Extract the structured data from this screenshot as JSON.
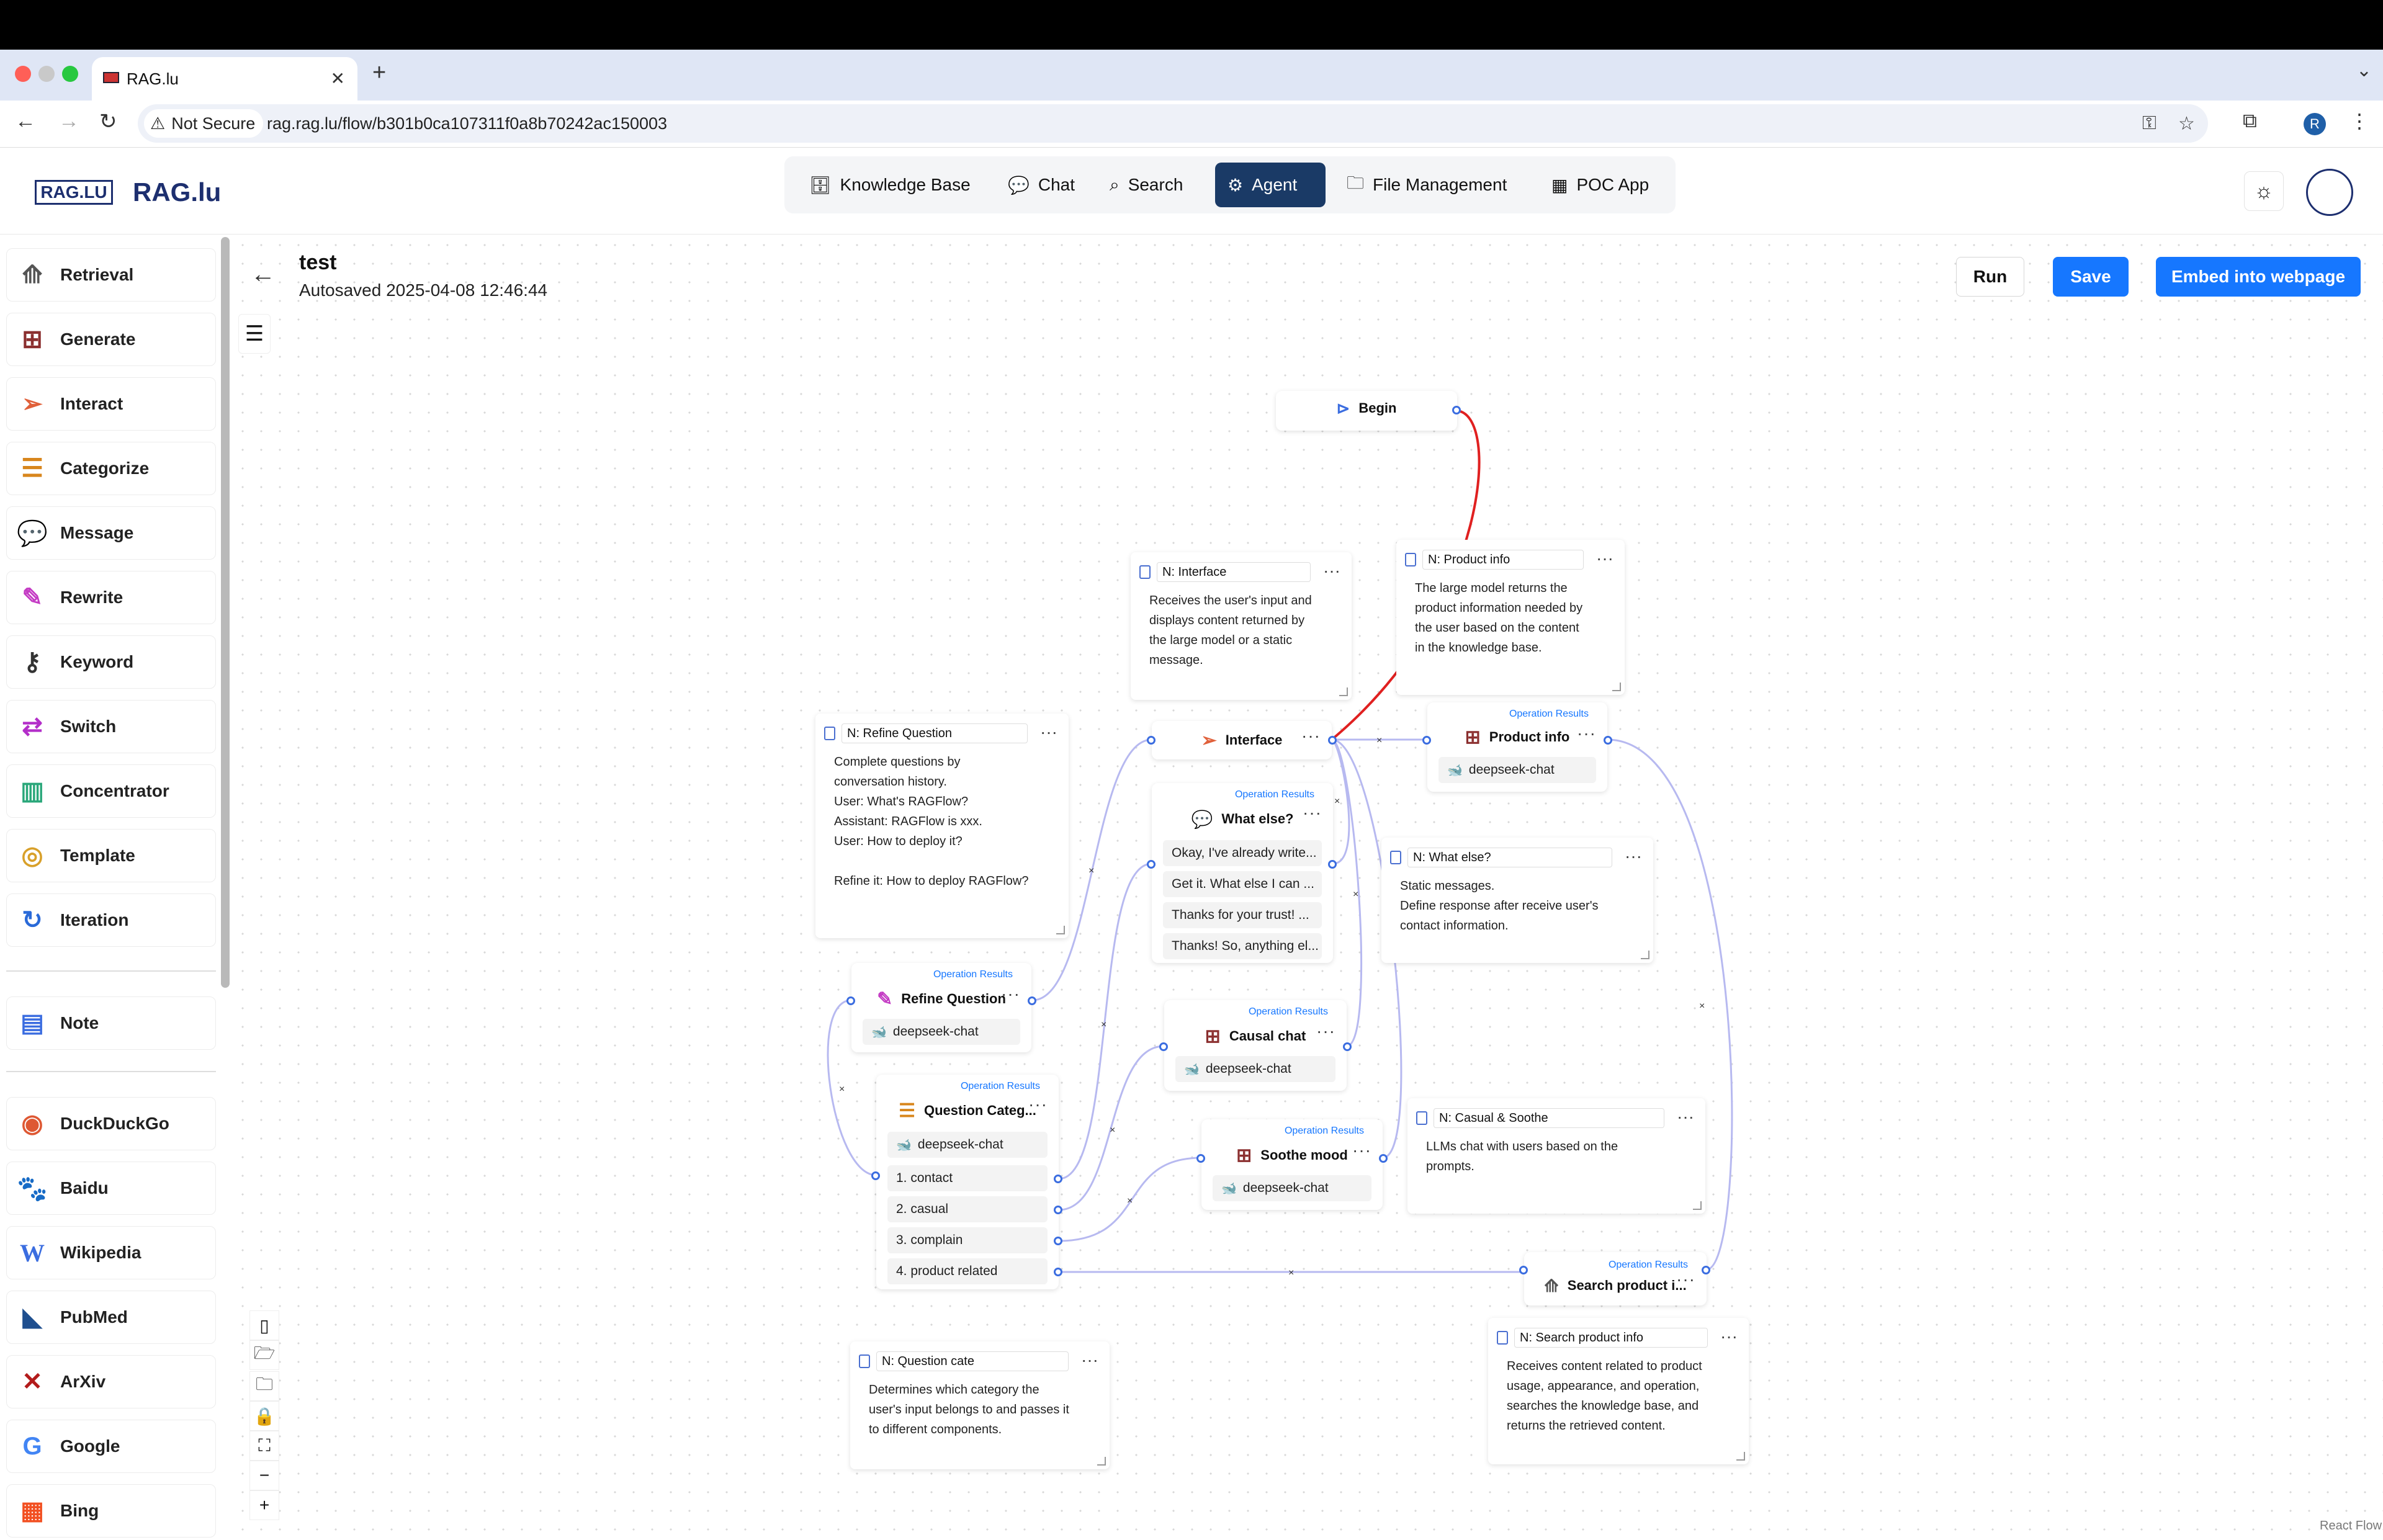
{
  "browser": {
    "tab_title": "RAG.lu",
    "not_secure": "Not Secure",
    "url": "rag.rag.lu/flow/b301b0ca107311f0a8b70242ac150003",
    "profile_initial": "R"
  },
  "app": {
    "logo_box": "RAG.LU",
    "logo_text": "RAG.lu",
    "nav": {
      "knowledge_base": "Knowledge Base",
      "chat": "Chat",
      "search": "Search",
      "agent": "Agent",
      "file_management": "File Management",
      "poc_app": "POC App"
    }
  },
  "sidebar": {
    "items": [
      "Retrieval",
      "Generate",
      "Interact",
      "Categorize",
      "Message",
      "Rewrite",
      "Keyword",
      "Switch",
      "Concentrator",
      "Template",
      "Iteration"
    ],
    "note": "Note",
    "tools": [
      "DuckDuckGo",
      "Baidu",
      "Wikipedia",
      "PubMed",
      "ArXiv",
      "Google",
      "Bing"
    ]
  },
  "flow": {
    "title": "test",
    "autosaved": "Autosaved 2025-04-08 12:46:44",
    "run": "Run",
    "save": "Save",
    "embed": "Embed into webpage",
    "attribution": "React Flow"
  },
  "common": {
    "operation_results": "Operation Results",
    "model": "deepseek-chat",
    "dots": "···"
  },
  "nodes": {
    "begin": "Begin",
    "interface": "Interface",
    "product_info": "Product info",
    "what_else": "What else?",
    "what_else_msgs": [
      "Okay, I've already write...",
      "Get it. What else I can ...",
      "Thanks for your trust! ...",
      "Thanks! So, anything el..."
    ],
    "refine_question": "Refine Question",
    "causal_chat": "Causal chat",
    "question_categ": "Question Categ...",
    "categories": [
      "1. contact",
      "2. casual",
      "3. complain",
      "4. product related"
    ],
    "soothe_mood": "Soothe mood",
    "search_product": "Search product i..."
  },
  "notes": {
    "interface": {
      "title": "N: Interface",
      "body": "Receives the user's input and\ndisplays content returned by\nthe large model or a static\nmessage."
    },
    "product_info": {
      "title": "N: Product info",
      "body": "The large model returns the\nproduct information needed by\nthe user based on the content\nin the knowledge base."
    },
    "refine_question": {
      "title": "N: Refine Question",
      "body": "Complete questions by\nconversation history.\nUser: What's RAGFlow?\nAssistant: RAGFlow is xxx.\nUser: How to deploy it?\n\nRefine it: How to deploy RAGFlow?"
    },
    "what_else": {
      "title": "N: What else?",
      "body": "Static messages.\nDefine response after receive user's\ncontact information."
    },
    "casual_soothe": {
      "title": "N: Casual & Soothe",
      "body": "LLMs chat with users based on the\nprompts."
    },
    "question_cate": {
      "title": "N: Question cate",
      "body": "Determines which category the\nuser's input belongs to and passes it\nto different components."
    },
    "search_product": {
      "title": "N: Search product info",
      "body": "Receives content related to product\nusage, appearance, and operation,\nsearches the knowledge base, and\nreturns the retrieved content."
    }
  },
  "colors": {
    "accent": "#1677ff",
    "nav_active": "#1a3a66",
    "edge": "#b7b9f0",
    "edge_active": "#e02020",
    "handle": "#3b6de0"
  }
}
